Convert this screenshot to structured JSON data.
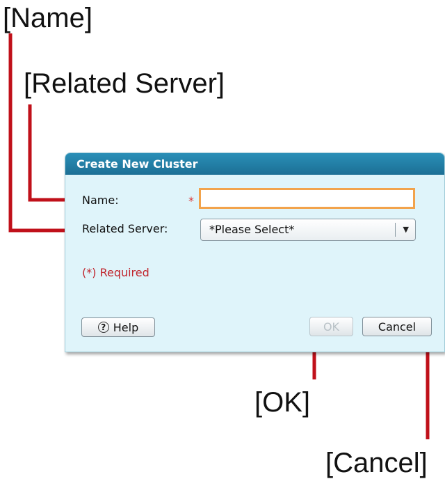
{
  "callouts": {
    "name": "[Name]",
    "related_server": "[Related Server]",
    "ok": "[OK]",
    "cancel": "[Cancel]"
  },
  "dialog": {
    "title": "Create New Cluster",
    "name_label": "Name:",
    "required_marker": "*",
    "name_value": "",
    "related_server_label": "Related Server:",
    "related_server_selected": "*Please Select*",
    "required_note": "(*) Required",
    "help_label": "Help",
    "ok_label": "OK",
    "cancel_label": "Cancel"
  },
  "colors": {
    "leader_line": "#c0101a",
    "titlebar": "#1f7aa3",
    "dialog_background": "#dff4fa",
    "required": "#d93a3a",
    "input_focus_border": "#f2a34c"
  }
}
